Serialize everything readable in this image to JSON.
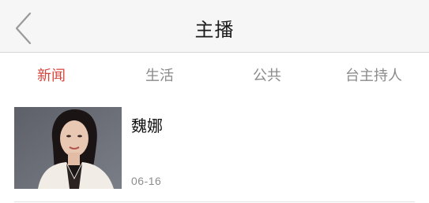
{
  "header": {
    "title": "主播",
    "back_icon": "chevron-left-icon"
  },
  "tabs": [
    {
      "label": "新闻",
      "active": true
    },
    {
      "label": "生活",
      "active": false
    },
    {
      "label": "公共",
      "active": false
    },
    {
      "label": "台主持人",
      "active": false
    }
  ],
  "colors": {
    "accent": "#d8443c",
    "header_bg": "#f6f6f6",
    "tab_inactive": "#8a8a8a"
  },
  "items": [
    {
      "title": "魏娜",
      "date": "06-16",
      "thumbnail": "portrait-photo"
    }
  ]
}
